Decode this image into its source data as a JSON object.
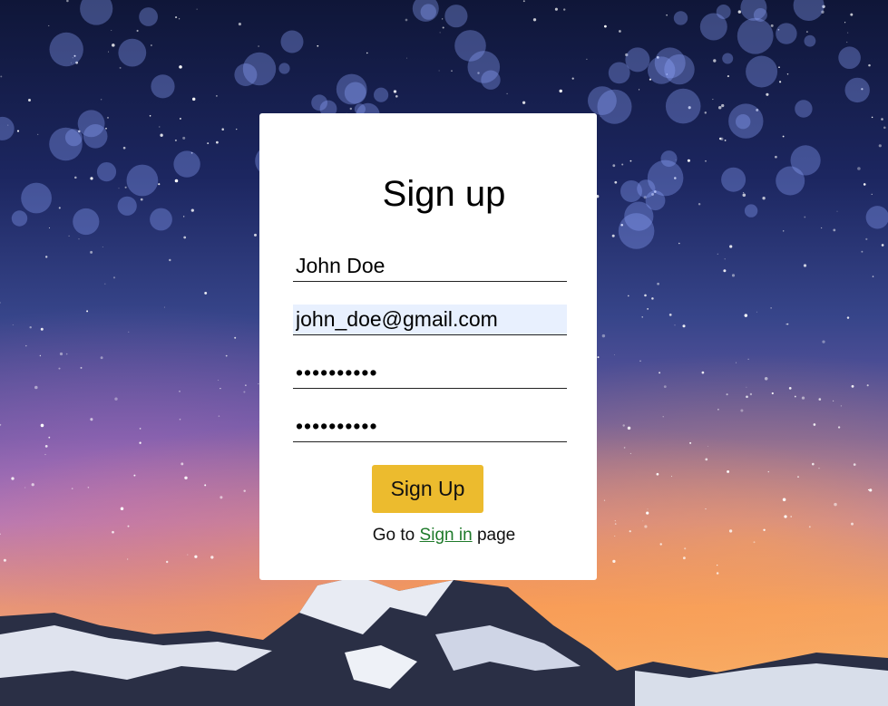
{
  "form": {
    "title": "Sign up",
    "name_value": "John Doe",
    "email_value": "john_doe@gmail.com",
    "password_value": "••••••••••",
    "confirm_password_value": "••••••••••",
    "submit_label": "Sign Up"
  },
  "footer": {
    "prefix": "Go to",
    "link_label": "Sign in",
    "suffix": "page"
  },
  "colors": {
    "button": "#ecbb2e",
    "link": "#1e7a2a",
    "autofill": "#e8f0fe",
    "card": "#ffffff"
  }
}
